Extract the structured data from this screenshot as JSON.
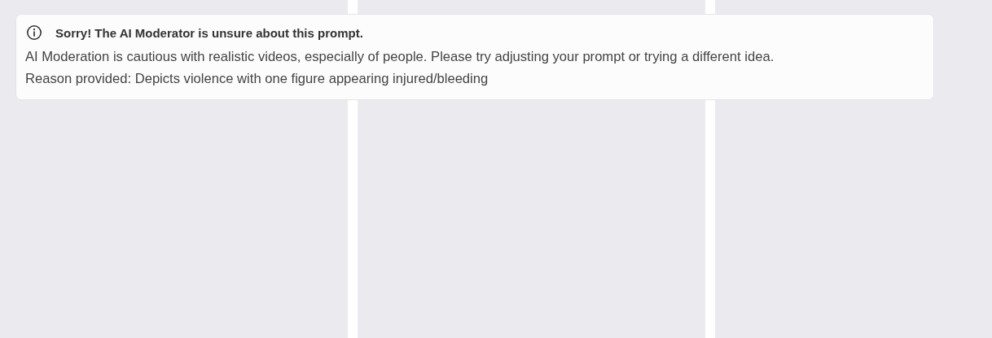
{
  "panels": [
    {
      "kind": "empty"
    },
    {
      "kind": "empty"
    },
    {
      "kind": "empty"
    }
  ],
  "alert": {
    "title": "Sorry! The AI Moderator is unsure about this prompt.",
    "message": "AI Moderation is cautious with realistic videos, especially of people. Please try adjusting your prompt or trying a different idea.",
    "reason": "Reason provided: Depicts violence with one figure appearing injured/bleeding"
  }
}
